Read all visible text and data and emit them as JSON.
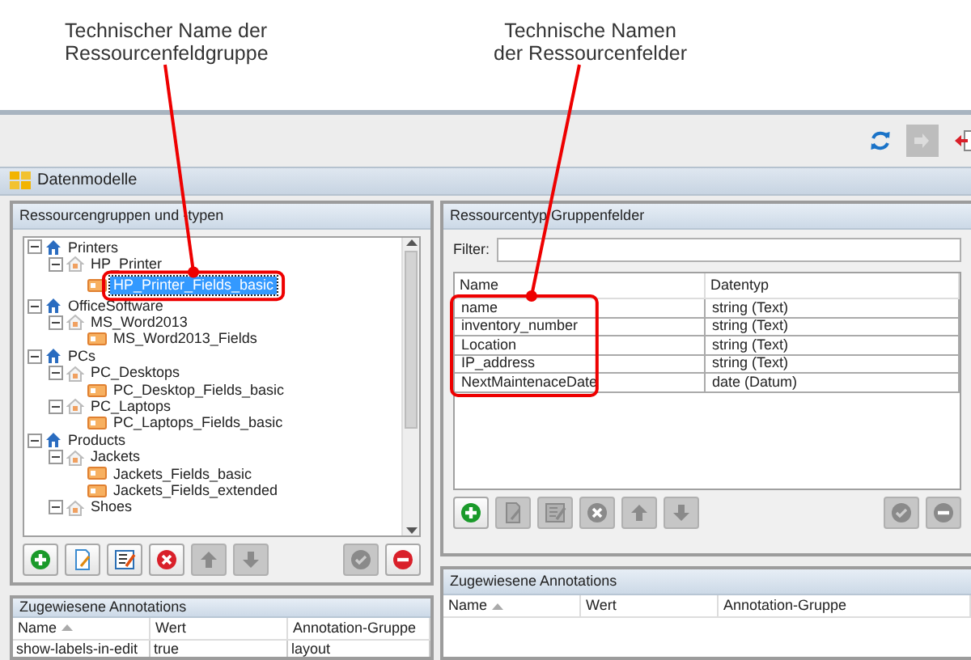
{
  "callouts": [
    {
      "text": "Technischer Name der\nRessourcenfeldgruppe"
    },
    {
      "text": "Technische Namen\nder Ressourcenfelder"
    }
  ],
  "toolbar": [
    {
      "kind": "refresh",
      "disabled": false
    },
    {
      "kind": "login",
      "disabled": true
    },
    {
      "kind": "exit",
      "disabled": false
    }
  ],
  "window": {
    "title": "Datenmodelle"
  },
  "left_panel": {
    "title": "Ressourcengruppen und -typen",
    "tree": [
      {
        "label": "Printers",
        "kind": "group",
        "expanded": true,
        "children": [
          {
            "label": "HP_Printer",
            "kind": "type",
            "expanded": true,
            "children": [
              {
                "label": "HP_Printer_Fields_basic",
                "kind": "fields",
                "selected": true
              }
            ]
          }
        ]
      },
      {
        "label": "OfficeSoftware",
        "kind": "group",
        "expanded": true,
        "children": [
          {
            "label": "MS_Word2013",
            "kind": "type",
            "expanded": true,
            "children": [
              {
                "label": "MS_Word2013_Fields",
                "kind": "fields",
                "selected": false
              }
            ]
          }
        ]
      },
      {
        "label": "PCs",
        "kind": "group",
        "expanded": true,
        "children": [
          {
            "label": "PC_Desktops",
            "kind": "type",
            "expanded": true,
            "children": [
              {
                "label": "PC_Desktop_Fields_basic",
                "kind": "fields",
                "selected": false
              }
            ]
          },
          {
            "label": "PC_Laptops",
            "kind": "type",
            "expanded": true,
            "children": [
              {
                "label": "PC_Laptops_Fields_basic",
                "kind": "fields",
                "selected": false
              }
            ]
          }
        ]
      },
      {
        "label": "Products",
        "kind": "group",
        "expanded": true,
        "children": [
          {
            "label": "Jackets",
            "kind": "type",
            "expanded": true,
            "children": [
              {
                "label": "Jackets_Fields_basic",
                "kind": "fields",
                "selected": false
              },
              {
                "label": "Jackets_Fields_extended",
                "kind": "fields",
                "selected": false
              }
            ]
          },
          {
            "label": "Shoes",
            "kind": "type",
            "expanded": true
          }
        ]
      }
    ],
    "buttons": [
      {
        "kind": "add",
        "disabled": false
      },
      {
        "kind": "edit",
        "disabled": false
      },
      {
        "kind": "edit-list",
        "disabled": false
      },
      {
        "kind": "delete",
        "disabled": false
      },
      {
        "kind": "up",
        "disabled": true
      },
      {
        "kind": "down",
        "disabled": true
      },
      {
        "kind": "gap"
      },
      {
        "kind": "confirm",
        "disabled": true
      },
      {
        "kind": "remove",
        "disabled": false
      }
    ]
  },
  "left_annotations": {
    "title": "Zugewiesene Annotations",
    "columns": [
      "Name",
      "Wert",
      "Annotation-Gruppe"
    ],
    "rows": [
      [
        "show-labels-in-edit",
        "true",
        "layout"
      ]
    ]
  },
  "right_panel": {
    "title": "Ressourcentyp Gruppenfelder",
    "filter_label": "Filter:",
    "columns": [
      "Name",
      "Datentyp"
    ],
    "rows": [
      [
        "name",
        "string (Text)"
      ],
      [
        "inventory_number",
        "string (Text)"
      ],
      [
        "Location",
        "string (Text)"
      ],
      [
        "IP_address",
        "string (Text)"
      ],
      [
        "NextMaintenaceDate",
        "date (Datum)"
      ]
    ],
    "buttons": [
      {
        "kind": "add",
        "disabled": false
      },
      {
        "kind": "edit",
        "disabled": true
      },
      {
        "kind": "edit-list",
        "disabled": true
      },
      {
        "kind": "delete",
        "disabled": true
      },
      {
        "kind": "up",
        "disabled": true
      },
      {
        "kind": "down",
        "disabled": true
      },
      {
        "kind": "gap"
      },
      {
        "kind": "confirm",
        "disabled": true
      },
      {
        "kind": "remove",
        "disabled": true
      }
    ]
  },
  "right_annotations": {
    "title": "Zugewiesene Annotations",
    "columns": [
      "Name",
      "Wert",
      "Annotation-Gruppe"
    ]
  }
}
